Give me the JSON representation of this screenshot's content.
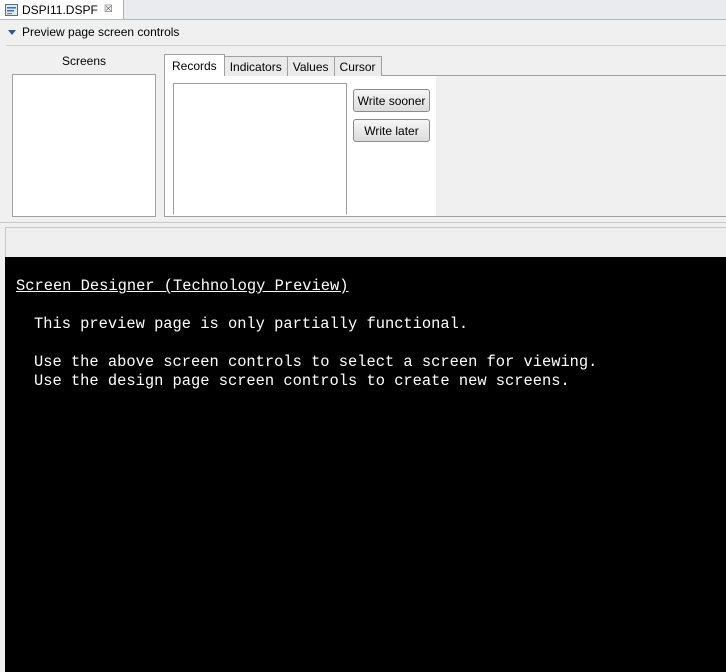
{
  "editor_tab": {
    "title": "DSPI11.DSPF",
    "icon": "display-file-icon",
    "close_icon": "close-icon"
  },
  "section": {
    "title": "Preview page screen controls",
    "twisty_icon": "chevron-down-icon"
  },
  "screens": {
    "label": "Screens",
    "items": []
  },
  "tabs": [
    {
      "label": "Records",
      "active": true
    },
    {
      "label": "Indicators",
      "active": false
    },
    {
      "label": "Values",
      "active": false
    },
    {
      "label": "Cursor",
      "active": false
    }
  ],
  "records": {
    "items": []
  },
  "buttons": {
    "write_sooner": "Write sooner",
    "write_later": "Write later"
  },
  "terminal": {
    "title": "Screen Designer (Technology Preview)",
    "line1": "This preview page is only partially functional.",
    "line2": "Use the above screen controls to select a screen for viewing.",
    "line3": "Use the design page screen controls to create new screens."
  },
  "colors": {
    "terminal_bg": "#000000",
    "terminal_fg": "#ffffff",
    "twisty": "#2a5a8a"
  }
}
